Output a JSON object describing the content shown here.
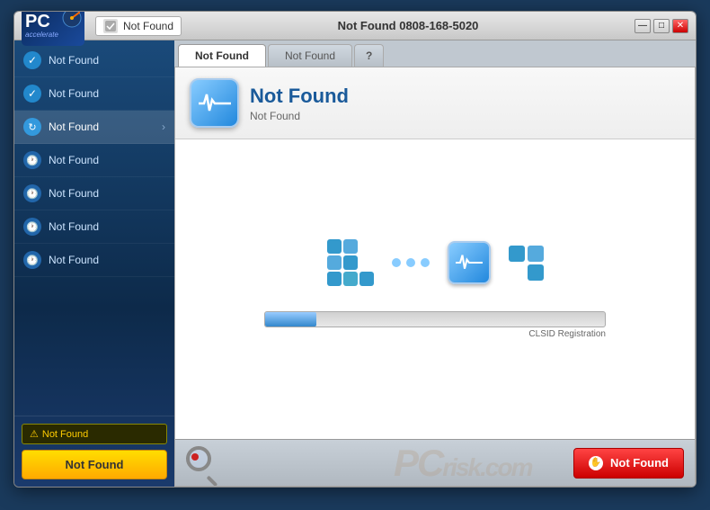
{
  "window": {
    "title": "PC Accelerate",
    "controls": {
      "minimize": "—",
      "maximize": "□",
      "close": "✕"
    }
  },
  "titlebar": {
    "status_label": "Not Found",
    "title_text": "Not Found  0808-168-5020"
  },
  "tabs": [
    {
      "label": "Not Found",
      "active": true
    },
    {
      "label": "Not Found",
      "active": false
    },
    {
      "label": "?",
      "active": false
    }
  ],
  "sidebar": {
    "items": [
      {
        "label": "Not Found",
        "icon": "check",
        "active": false
      },
      {
        "label": "Not Found",
        "icon": "check",
        "active": false
      },
      {
        "label": "Not Found",
        "icon": "refresh",
        "active": true,
        "has_chevron": true
      },
      {
        "label": "Not Found",
        "icon": "clock",
        "active": false
      },
      {
        "label": "Not Found",
        "icon": "clock",
        "active": false
      },
      {
        "label": "Not Found",
        "icon": "clock",
        "active": false
      },
      {
        "label": "Not Found",
        "icon": "clock",
        "active": false
      }
    ],
    "warning_label": "Not Found",
    "cta_button": "Not Found"
  },
  "panel": {
    "title": "Not Found",
    "subtitle": "Not Found",
    "tab_active": "Not Found",
    "tab_inactive": "Not Found"
  },
  "progress": {
    "label": "CLSID Registration",
    "fill_percent": 15
  },
  "bottom": {
    "action_button": "Not Found",
    "pcrisk": "PC",
    "pcrisk_suffix": "risk.com"
  }
}
